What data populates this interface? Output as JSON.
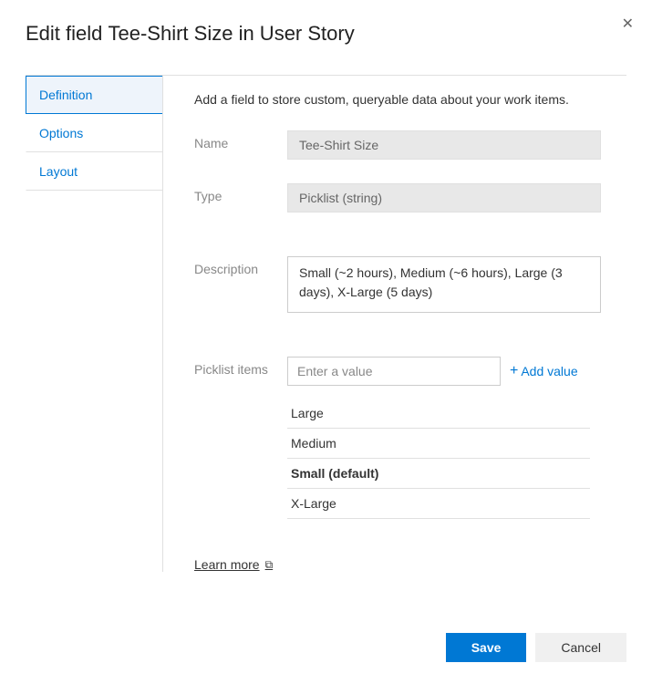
{
  "header": {
    "prefix": "Edit field ",
    "field_name": "Tee-Shirt Size",
    "suffix": " in User Story"
  },
  "tabs": {
    "definition": "Definition",
    "options": "Options",
    "layout": "Layout"
  },
  "content": {
    "intro": "Add a field to store custom, queryable data about your work items.",
    "labels": {
      "name": "Name",
      "type": "Type",
      "description": "Description",
      "picklist": "Picklist items"
    },
    "values": {
      "name": "Tee-Shirt Size",
      "type": "Picklist (string)",
      "description": "Small (~2 hours), Medium (~6 hours), Large (3 days), X-Large (5 days)"
    },
    "picklist": {
      "placeholder": "Enter a value",
      "add_value": "Add value",
      "items": [
        {
          "label": "Large",
          "default": false
        },
        {
          "label": "Medium",
          "default": false
        },
        {
          "label": "Small (default)",
          "default": true
        },
        {
          "label": "X-Large",
          "default": false
        }
      ]
    },
    "learn_more": "Learn more"
  },
  "footer": {
    "save": "Save",
    "cancel": "Cancel"
  }
}
